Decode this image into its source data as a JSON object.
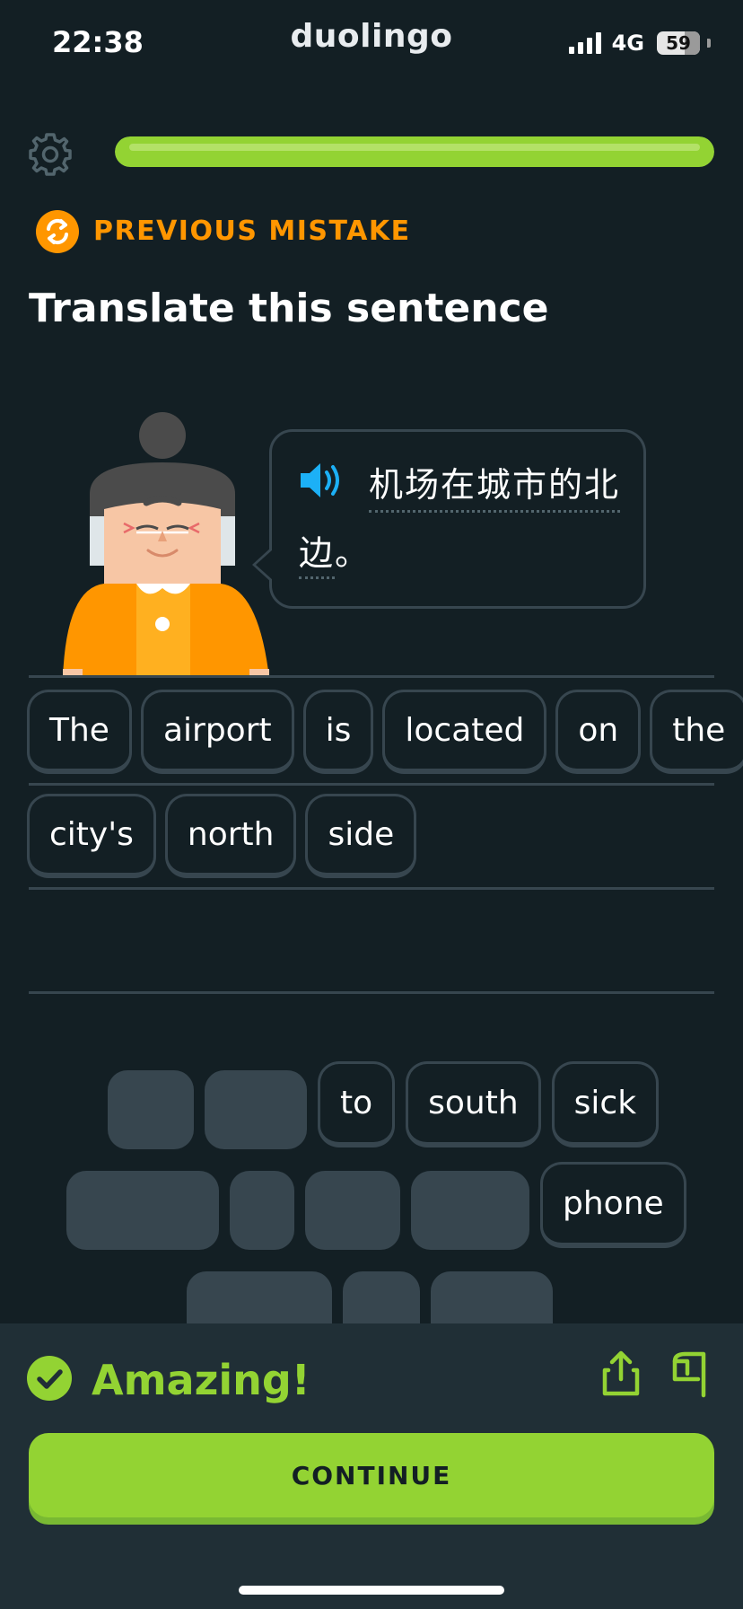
{
  "status_bar": {
    "time": "22:38",
    "brand": "duolingo",
    "network": "4G",
    "battery": "59"
  },
  "header": {
    "progress_fraction": 1.0,
    "mistake_label": "PREVIOUS MISTAKE"
  },
  "prompt": {
    "title": "Translate this sentence",
    "sentence_line1": "机场在城市的北",
    "sentence_line2_word": "边",
    "sentence_line2_punct": "。"
  },
  "answer": {
    "row1": [
      "The",
      "airport",
      "is",
      "located",
      "on",
      "the"
    ],
    "row2": [
      "city's",
      "north",
      "side"
    ]
  },
  "word_bank": {
    "row1_words": [
      "to",
      "south",
      "sick"
    ],
    "row2_words": [
      "phone"
    ]
  },
  "feedback": {
    "title": "Amazing!",
    "continue_label": "CONTINUE"
  },
  "colors": {
    "background": "#131f24",
    "accent_green": "#93d333",
    "mistake_orange": "#ff9600",
    "speaker_blue": "#1cb0f6",
    "border": "#37464f"
  },
  "icons": [
    "gear-icon",
    "repeat-icon",
    "speaker-icon",
    "check-circle-icon",
    "share-icon",
    "flag-icon",
    "signal-icon",
    "battery-icon"
  ]
}
